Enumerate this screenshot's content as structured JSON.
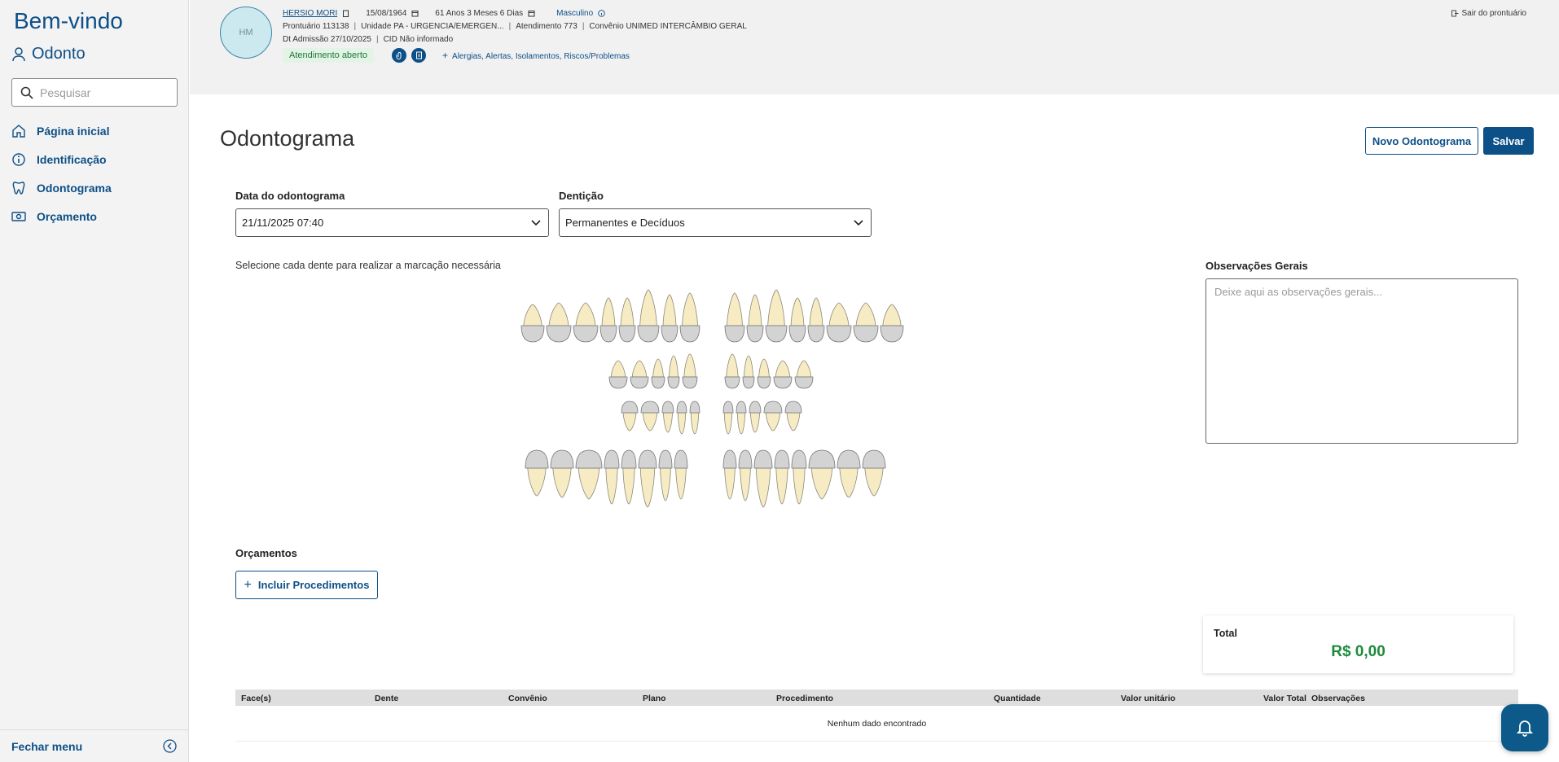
{
  "sidebar": {
    "welcome": "Bem-vindo",
    "module": "Odonto",
    "search_placeholder": "Pesquisar",
    "items": [
      {
        "label": "Página inicial",
        "icon": "home-icon"
      },
      {
        "label": "Identificação",
        "icon": "info-icon"
      },
      {
        "label": "Odontograma",
        "icon": "tooth-icon"
      },
      {
        "label": "Orçamento",
        "icon": "money-icon"
      }
    ],
    "close_menu": "Fechar menu"
  },
  "patient": {
    "initials": "HM",
    "name": "HERSIO MORI",
    "birthdate": "15/08/1964",
    "age": "61 Anos 3 Meses 6 Dias",
    "sex": "Masculino",
    "record": "Prontuário 113138",
    "unit": "Unidade PA - URGENCIA/EMERGEN...",
    "attendance": "Atendimento 773",
    "insurance": "Convênio UNIMED INTERCÂMBIO GERAL",
    "admission": "Dt Admissão 27/10/2025",
    "cid": "CID Não informado",
    "status": "Atendimento aberto",
    "alerts_link": "Alergias, Alertas, Isolamentos, Riscos/Problemas",
    "exit": "Sair do prontuário"
  },
  "page": {
    "title": "Odontograma",
    "new_button": "Novo Odontograma",
    "save_button": "Salvar",
    "date_label": "Data do odontograma",
    "date_value": "21/11/2025 07:40",
    "dentition_label": "Dentição",
    "dentition_value": "Permanentes e Decíduos",
    "hint": "Selecione cada dente para realizar a marcação necessária",
    "obs_label": "Observações Gerais",
    "obs_placeholder": "Deixe aqui as observações gerais...",
    "budgets_label": "Orçamentos",
    "add_procedures": "Incluir Procedimentos",
    "total_label": "Total",
    "total_value": "R$ 0,00"
  },
  "table": {
    "columns": [
      "Face(s)",
      "Dente",
      "Convênio",
      "Plano",
      "Procedimento",
      "Quantidade",
      "Valor unitário",
      "Valor Total",
      "Observações"
    ],
    "empty": "Nenhum dado encontrado"
  },
  "colors": {
    "primary": "#0d4f87",
    "success": "#1e8a3c",
    "tooth_root": "#f7ebc4",
    "tooth_crown": "#d3d3d3"
  }
}
